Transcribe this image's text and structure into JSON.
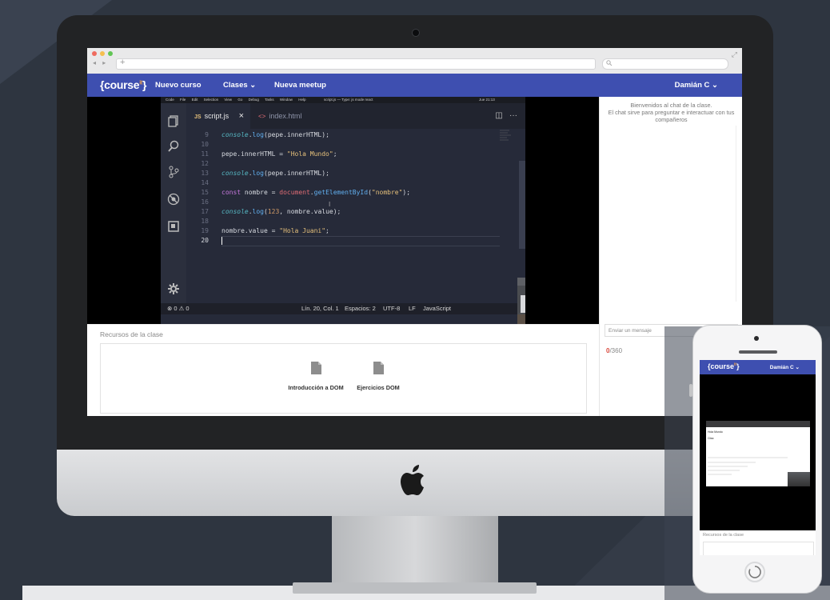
{
  "browser": {
    "dots": [
      "#ef6b5f",
      "#f5bf4f",
      "#61c554"
    ]
  },
  "app": {
    "logo": "{course",
    "logo_sup": "it",
    "logo_end": "}",
    "nav": [
      "Nuevo curso",
      "Clases ⌄",
      "Nueva meetup"
    ],
    "user": "Damián C ⌄",
    "brand_color": "#3e4fb0"
  },
  "editor": {
    "menubar": [
      "Code",
      "File",
      "Edit",
      "Selection",
      "View",
      "Go",
      "Debug",
      "Tasks",
      "Window",
      "Help"
    ],
    "window_title": "script.js — Type: js mode react",
    "clock": "Jue 21:13",
    "tab_active": "script.js",
    "tab_active_badge": "JS",
    "tab_inactive": "index.html",
    "tab_inactive_badge": "<>",
    "close_glyph": "×",
    "line_numbers": [
      "9",
      "10",
      "11",
      "12",
      "13",
      "14",
      "15",
      "16",
      "17",
      "18",
      "19",
      "20"
    ],
    "status": {
      "problems": "⊗ 0  ⚠ 0",
      "position": "Lín. 20, Col. 1",
      "spaces": "Espacios: 2",
      "encoding": "UTF-8",
      "eol": "LF",
      "language": "JavaScript"
    }
  },
  "chat": {
    "welcome_1": "Bienvenidos al chat de la clase.",
    "welcome_2": "El chat sirve para preguntar e interactuar con tus compañeros",
    "input_placeholder": "Enviar un mensaje",
    "count_current": "0",
    "count_max": "/360"
  },
  "resources": {
    "title": "Recursos de la clase",
    "items": [
      {
        "label": "Introducción a DOM"
      },
      {
        "label": "Ejercicios DOM"
      }
    ]
  },
  "phone": {
    "logo": "{course",
    "logo_sup": "it",
    "logo_end": "}",
    "user": "Damián C ⌄",
    "video_text_1": "Hola Mundo",
    "video_text_2": "Cfaa",
    "resources_title": "Recursos de la clase"
  }
}
